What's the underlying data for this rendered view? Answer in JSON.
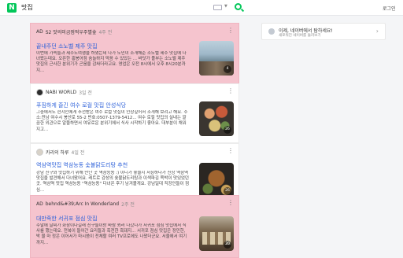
{
  "header": {
    "logo": "N",
    "query": "맛집",
    "login": "로그인"
  },
  "banner": {
    "main": "이제, 네이버에서 탐하세요!",
    "sub": "새로워진 네이버를 둘러보기"
  },
  "cards": [
    {
      "ad": "AD",
      "author": "S2 맛의미금점적우주별숲",
      "ago": "4주 전",
      "title": "끝내주던 소노벨 제주 맛집",
      "desc": "이번에 가족들과 제주도여행을 하였는데 다가 도민이 소개해준 소노벨 제주 맛집에 다녀왔는데요. 오픈한 홍봉어점 숨늘하지 막음 수 있었는 ... 바닷가 플부는 소노벨 제주 맛집의 근사한 분위기가 곤움을 감싸더라고요. 영업은 오전 8시에서 오후 8시20분까지...",
      "count": "4"
    },
    {
      "ad": "",
      "author": "NABI WORLD",
      "ago": "3일 전",
      "title": "푸짐하게 즐긴 여수 로컬 맛집 안성식당",
      "desc": "그중에서도 현지인에게 추천받은 여수 로컬 맛집이 인상깊어서 소개해 보려고 해요. 주소:전남 여수시 봉산로 55-2 번호:0507-1379-5412... 여수 로컬 맛집의 실내는 깔끔한 외관으로 알뜰하면서 여유로운 분위기에서 식사 시작하기 좋아요. 대부분이 채워지고...",
      "count": "26"
    },
    {
      "ad": "",
      "author": "카리의 하루",
      "ago": "4일 전",
      "title": "역삼역맛집 역삼능동 숯불닭도리탕 추천",
      "desc": "강남 친구와 맛집하기 위해 만난 곳 역삼능동 :) 이디가 좋을지 서칭하다가 신상 역삼역 맛집을 발견해서 다녀왔어요. 레트로 감성의 숯불닭도리탕과 이색파김 쪽박이 맛있었던 곳. 역삼역 맛집 역삼능동 \"역삼능동\" 다녀온 후기 남겨볼게요. 강남일대 직장인들이 점심...",
      "count": "26"
    },
    {
      "ad": "AD",
      "author": "behnd&#39;Arc In Wonderland",
      "ago": "2주 전",
      "title": "대만족한 서귀포 점심 맛집",
      "desc": "주말에 날씨가 화창이다길래 친구들이랑 바람 쐬러 나갔다가 서귀포 점심 맛집에서 식사를 했는데요. 전복이 들어간 요리들과 흑전한 흑돼지... 서귀포 점심 맛집은 정민한, 박 물 마 정은 이어서가 마시씀이 전체할 여러 TV프로에도 나왔더군요. 서울에서 여기까지...",
      "count": "20"
    }
  ]
}
